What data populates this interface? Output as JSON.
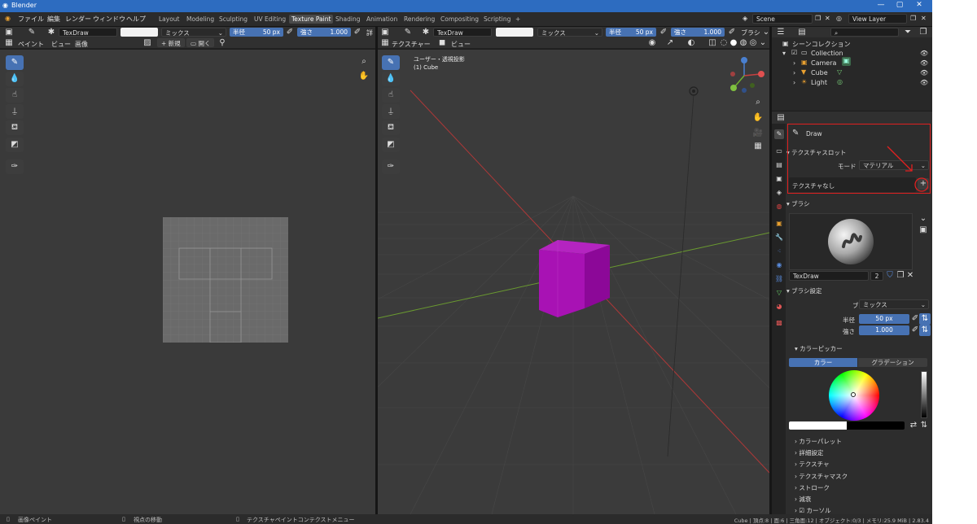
{
  "window": {
    "title": "Blender"
  },
  "menu": [
    "ファイル",
    "編集",
    "レンダー",
    "ウィンドウ",
    "ヘルプ"
  ],
  "workspaces": [
    "Layout",
    "Modeling",
    "Sculpting",
    "UV Editing",
    "Texture Paint",
    "Shading",
    "Animation",
    "Rendering",
    "Compositing",
    "Scripting",
    "+"
  ],
  "active_workspace": "Texture Paint",
  "scene": {
    "scene_name": "Scene",
    "view_layer": "View Layer"
  },
  "image_editor": {
    "brush_name": "TexDraw",
    "blend": "ミックス",
    "radius_label": "半径",
    "radius_value": "50 px",
    "strength_label": "強さ",
    "strength_value": "1.000",
    "overflow": "詳",
    "mode": "ペイント",
    "view": "ビュー",
    "image": "画像",
    "new": "新規",
    "open": "開く"
  },
  "viewport": {
    "brush_name": "TexDraw",
    "blend": "ミックス",
    "radius_label": "半径",
    "radius_value": "50 px",
    "strength_label": "強さ",
    "strength_value": "1.000",
    "overflow": "ブラシ",
    "mode": "テクスチャー",
    "view": "ビュー",
    "view_label": "ユーザー・透視投影",
    "object_label": "(1) Cube"
  },
  "outliner": {
    "title": "シーンコレクション",
    "items": [
      {
        "label": "Collection"
      },
      {
        "label": "Camera"
      },
      {
        "label": "Cube"
      },
      {
        "label": "Light"
      }
    ]
  },
  "properties": {
    "brush_title": "Draw",
    "texture_slots_header": "テクスチャスロット",
    "mode_label": "モード",
    "mode_value": "マテリアル",
    "no_texture": "テクスチャなし",
    "add": "+",
    "brush_header": "ブラシ",
    "brush_name": "TexDraw",
    "brush_users": "2",
    "brush_settings_header": "ブラシ設定",
    "blend_label": "ブレンド",
    "blend_value": "ミックス",
    "radius_label": "半径",
    "radius_value": "50 px",
    "strength_label": "強さ",
    "strength_value": "1.000",
    "color_picker_header": "カラーピッカー",
    "tab_color": "カラー",
    "tab_gradient": "グラデーション",
    "subpanels": [
      "カラーパレット",
      "詳細設定",
      "テクスチャ",
      "テクスチャマスク",
      "ストローク",
      "減衰",
      "カーソル"
    ]
  },
  "statusbar": {
    "left": "画像ペイント",
    "middle": "視点の移動",
    "right_hint": "テクスチャペイントコンテクストメニュー",
    "stats": "Cube | 頂点:8 | 面:6 | 三角面:12 | オブジェクト:0/3 | メモリ:25.9 MiB | 2.83.4"
  },
  "colors": {
    "accent": "#4772b3",
    "cube": "#a010b0",
    "annotation": "#e02020"
  }
}
